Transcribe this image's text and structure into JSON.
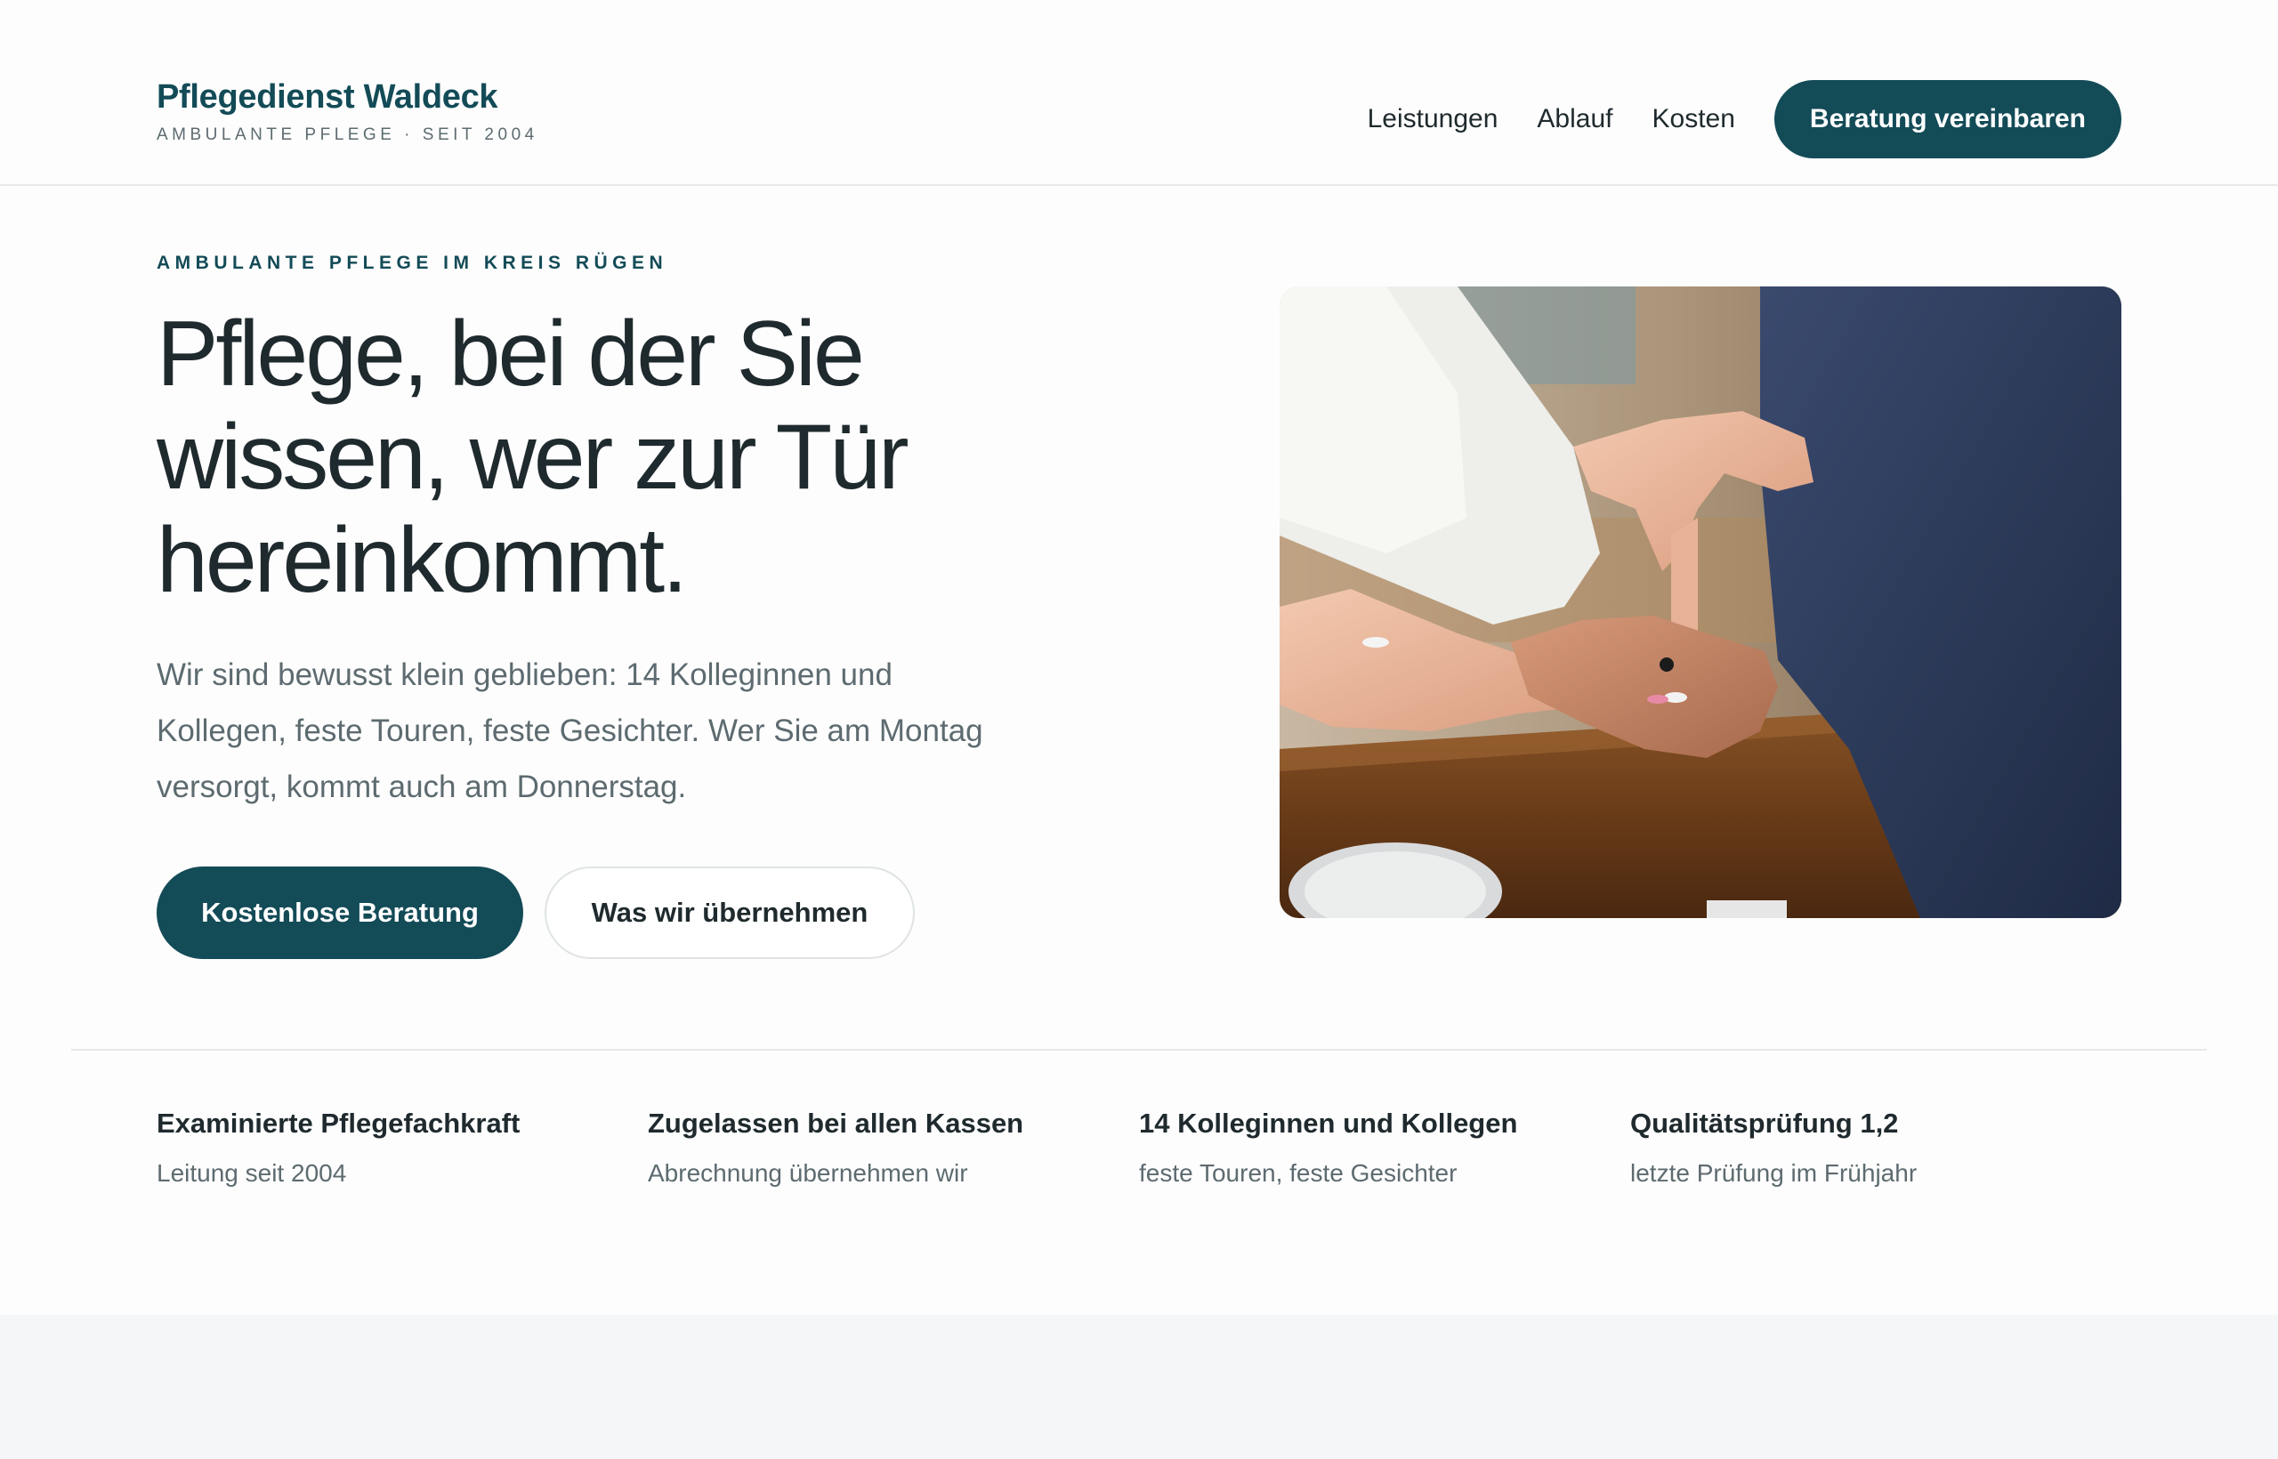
{
  "header": {
    "brand_name": "Pflegedienst Waldeck",
    "brand_tagline": "AMBULANTE PFLEGE · SEIT 2004",
    "nav": [
      "Leistungen",
      "Ablauf",
      "Kosten"
    ],
    "cta_label": "Beratung vereinbaren"
  },
  "hero": {
    "eyebrow": "AMBULANTE PFLEGE IM KREIS RÜGEN",
    "title_lines": [
      "Pflege, bei der Sie",
      "wissen, wer zur Tür",
      "hereinkommt."
    ],
    "text": "Wir sind bewusst klein geblieben: 14 Kolleginnen und Kollegen, feste Touren, feste Gesichter. Wer Sie am Montag versorgt, kommt auch am Donnerstag.",
    "primary_button": "Kostenlose Beratung",
    "secondary_button": "Was wir übernehmen"
  },
  "stats": [
    {
      "title": "Examinierte Pflegefachkraft",
      "sub": "Leitung seit 2004"
    },
    {
      "title": "Zugelassen bei allen Kassen",
      "sub": "Abrechnung übernehmen wir"
    },
    {
      "title": "14 Kolleginnen und Kollegen",
      "sub": "feste Touren, feste Gesichter"
    },
    {
      "title": "Qualitätsprüfung 1,2",
      "sub": "letzte Prüfung im Frühjahr"
    }
  ],
  "colors": {
    "brand": "#134b57",
    "text": "#1f2a2e",
    "muted": "#5d6b70",
    "background": "#fdfdfd"
  }
}
